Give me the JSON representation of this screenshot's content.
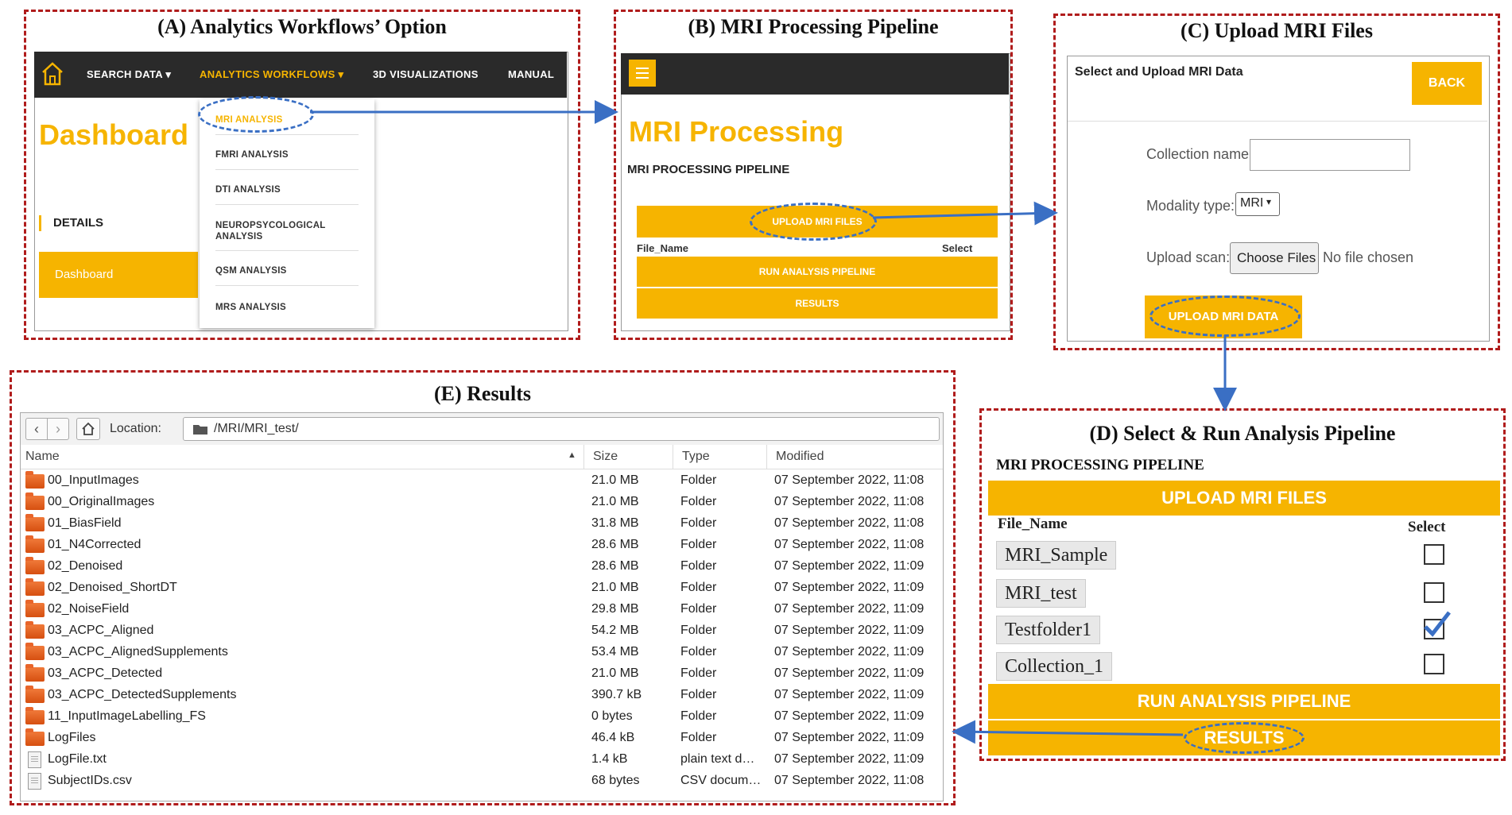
{
  "panel_a": {
    "title": "(A)  Analytics Workflows’ Option",
    "nav": {
      "search": "SEARCH DATA",
      "analytics": "ANALYTICS WORKFLOWS",
      "viz": "3D VISUALIZATIONS",
      "manual": "MANUAL"
    },
    "dashboard_heading": "Dashboard",
    "details_label": "DETAILS",
    "dashboard_button": "Dashboard",
    "menu": [
      "MRI ANALYSIS",
      "FMRI ANALYSIS",
      "DTI ANALYSIS",
      "NEUROPSYCOLOGICAL ANALYSIS",
      "QSM ANALYSIS",
      "MRS ANALYSIS"
    ]
  },
  "panel_b": {
    "title": "(B) MRI Processing Pipeline",
    "heading": "MRI Processing",
    "subheading": "MRI PROCESSING PIPELINE",
    "upload_button": "UPLOAD MRI FILES",
    "file_name_col": "File_Name",
    "select_col": "Select",
    "run_button": "RUN ANALYSIS PIPELINE",
    "results_button": "RESULTS"
  },
  "panel_c": {
    "title": "(C) Upload MRI Files",
    "header": "Select and Upload MRI Data",
    "back_button": "BACK",
    "collection_label": "Collection name:",
    "modality_label": "Modality type:",
    "modality_value": "MRI",
    "upload_scan_label": "Upload scan:",
    "choose_files": "Choose Files",
    "no_file": "No file chosen",
    "upload_button": "UPLOAD MRI DATA"
  },
  "panel_d": {
    "title": "(D) Select & Run Analysis Pipeline",
    "subheading": "MRI PROCESSING PIPELINE",
    "upload_button": "UPLOAD MRI FILES",
    "file_name_col": "File_Name",
    "select_col": "Select",
    "files": [
      {
        "name": "MRI_Sample",
        "checked": false
      },
      {
        "name": "MRI_test",
        "checked": false
      },
      {
        "name": "Testfolder1",
        "checked": true
      },
      {
        "name": "Collection_1",
        "checked": false
      }
    ],
    "run_button": "RUN ANALYSIS PIPELINE",
    "results_button": "RESULTS"
  },
  "panel_e": {
    "title": "(E) Results",
    "location_label": "Location:",
    "location_path": "/MRI/MRI_test/",
    "columns": {
      "name": "Name",
      "size": "Size",
      "type": "Type",
      "modified": "Modified"
    },
    "rows": [
      {
        "name": "00_InputImages",
        "size": "21.0 MB",
        "type": "Folder",
        "modified": "07 September 2022, 11:08",
        "icon": "folder-icon"
      },
      {
        "name": "00_OriginalImages",
        "size": "21.0 MB",
        "type": "Folder",
        "modified": "07 September 2022, 11:08",
        "icon": "folder-icon"
      },
      {
        "name": "01_BiasField",
        "size": "31.8 MB",
        "type": "Folder",
        "modified": "07 September 2022, 11:08",
        "icon": "folder-icon"
      },
      {
        "name": "01_N4Corrected",
        "size": "28.6 MB",
        "type": "Folder",
        "modified": "07 September 2022, 11:08",
        "icon": "folder-icon"
      },
      {
        "name": "02_Denoised",
        "size": "28.6 MB",
        "type": "Folder",
        "modified": "07 September 2022, 11:09",
        "icon": "folder-icon"
      },
      {
        "name": "02_Denoised_ShortDT",
        "size": "21.0 MB",
        "type": "Folder",
        "modified": "07 September 2022, 11:09",
        "icon": "folder-icon"
      },
      {
        "name": "02_NoiseField",
        "size": "29.8 MB",
        "type": "Folder",
        "modified": "07 September 2022, 11:09",
        "icon": "folder-icon"
      },
      {
        "name": "03_ACPC_Aligned",
        "size": "54.2 MB",
        "type": "Folder",
        "modified": "07 September 2022, 11:09",
        "icon": "folder-icon"
      },
      {
        "name": "03_ACPC_AlignedSupplements",
        "size": "53.4 MB",
        "type": "Folder",
        "modified": "07 September 2022, 11:09",
        "icon": "folder-icon"
      },
      {
        "name": "03_ACPC_Detected",
        "size": "21.0 MB",
        "type": "Folder",
        "modified": "07 September 2022, 11:09",
        "icon": "folder-icon"
      },
      {
        "name": "03_ACPC_DetectedSupplements",
        "size": "390.7 kB",
        "type": "Folder",
        "modified": "07 September 2022, 11:09",
        "icon": "folder-icon"
      },
      {
        "name": "11_InputImageLabelling_FS",
        "size": "0 bytes",
        "type": "Folder",
        "modified": "07 September 2022, 11:09",
        "icon": "folder-icon"
      },
      {
        "name": "LogFiles",
        "size": "46.4 kB",
        "type": "Folder",
        "modified": "07 September 2022, 11:09",
        "icon": "folder-icon"
      },
      {
        "name": "LogFile.txt",
        "size": "1.4 kB",
        "type": "plain text d…",
        "modified": "07 September 2022, 11:09",
        "icon": "text-file-icon"
      },
      {
        "name": "SubjectIDs.csv",
        "size": "68 bytes",
        "type": "CSV docum…",
        "modified": "07 September 2022, 11:08",
        "icon": "csv-file-icon"
      }
    ]
  },
  "colors": {
    "accent": "#f6b400",
    "panel_border": "#b01c1c",
    "arrow": "#3a6fc4"
  }
}
